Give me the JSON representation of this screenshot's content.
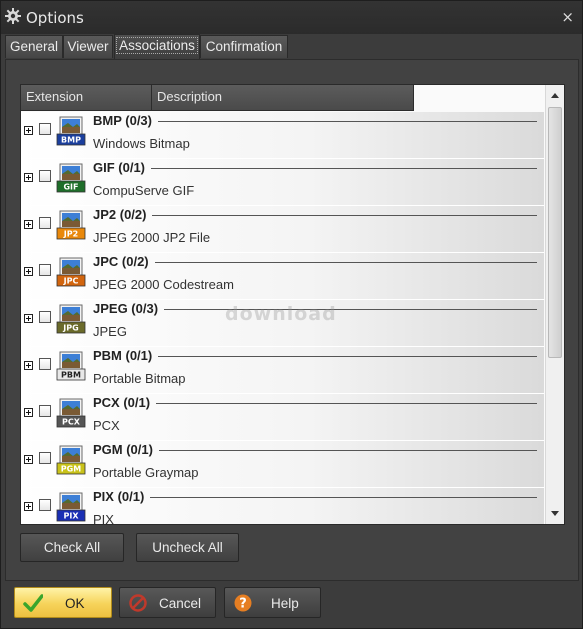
{
  "window": {
    "title": "Options",
    "close_glyph": "×"
  },
  "tabs": [
    {
      "label": "General",
      "active": false
    },
    {
      "label": "Viewer",
      "active": false
    },
    {
      "label": "Associations",
      "active": true
    },
    {
      "label": "Confirmation",
      "active": false
    }
  ],
  "list": {
    "columns": [
      "Extension",
      "Description"
    ],
    "rows": [
      {
        "name": "BMP (0/3)",
        "description": "Windows Bitmap",
        "icon_label": "BMP",
        "icon_color": "#1b3f9e"
      },
      {
        "name": "GIF (0/1)",
        "description": "CompuServe GIF",
        "icon_label": "GIF",
        "icon_color": "#1e6e2a"
      },
      {
        "name": "JP2 (0/2)",
        "description": "JPEG 2000 JP2 File",
        "icon_label": "JP2",
        "icon_color": "#e9880b"
      },
      {
        "name": "JPC (0/2)",
        "description": "JPEG 2000 Codestream",
        "icon_label": "JPC",
        "icon_color": "#d2650e"
      },
      {
        "name": "JPEG (0/3)",
        "description": "JPEG",
        "icon_label": "JPG",
        "icon_color": "#6a6a2a"
      },
      {
        "name": "PBM (0/1)",
        "description": "Portable Bitmap",
        "icon_label": "PBM",
        "icon_color": "#e8e8e8"
      },
      {
        "name": "PCX (0/1)",
        "description": "PCX",
        "icon_label": "PCX",
        "icon_color": "#555555"
      },
      {
        "name": "PGM (0/1)",
        "description": "Portable Graymap",
        "icon_label": "PGM",
        "icon_color": "#c9c21a"
      },
      {
        "name": "PIX (0/1)",
        "description": "PIX",
        "icon_label": "PIX",
        "icon_color": "#1a2fb4"
      }
    ],
    "watermark": "download"
  },
  "buttons": {
    "check_all": "Check All",
    "uncheck_all": "Uncheck All",
    "ok": "OK",
    "cancel": "Cancel",
    "help": "Help"
  },
  "colors": {
    "ok_accent": "#f6d35a",
    "cancel_icon": "#c0392b",
    "help_icon": "#e67e22",
    "check_icon": "#3aa52c"
  }
}
